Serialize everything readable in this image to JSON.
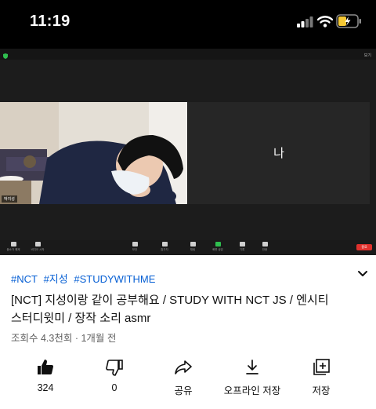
{
  "status_bar": {
    "time": "11:19"
  },
  "video": {
    "view_label": "보기",
    "participant_name": "박지성",
    "self_label": "나",
    "toolbar": [
      {
        "label": "음소거 해제"
      },
      {
        "label": "비디오 시작"
      },
      {
        "label": "보안"
      },
      {
        "label": "참가자"
      },
      {
        "label": "채팅"
      },
      {
        "label": "화면 공유"
      },
      {
        "label": "기록"
      },
      {
        "label": "반응"
      }
    ],
    "end_label": "종료"
  },
  "hashtags": [
    "#NCT",
    "#지성",
    "#STUDYWITHME"
  ],
  "title": "[NCT] 지성이랑 같이 공부해요 / STUDY WITH NCT JS / 엔시티 스터디윗미 / 장작 소리 asmr",
  "meta": "조회수 4.3천회 · 1개월 전",
  "actions": {
    "like": "324",
    "dislike": "0",
    "share": "공유",
    "download": "오프라인 저장",
    "save": "저장"
  }
}
